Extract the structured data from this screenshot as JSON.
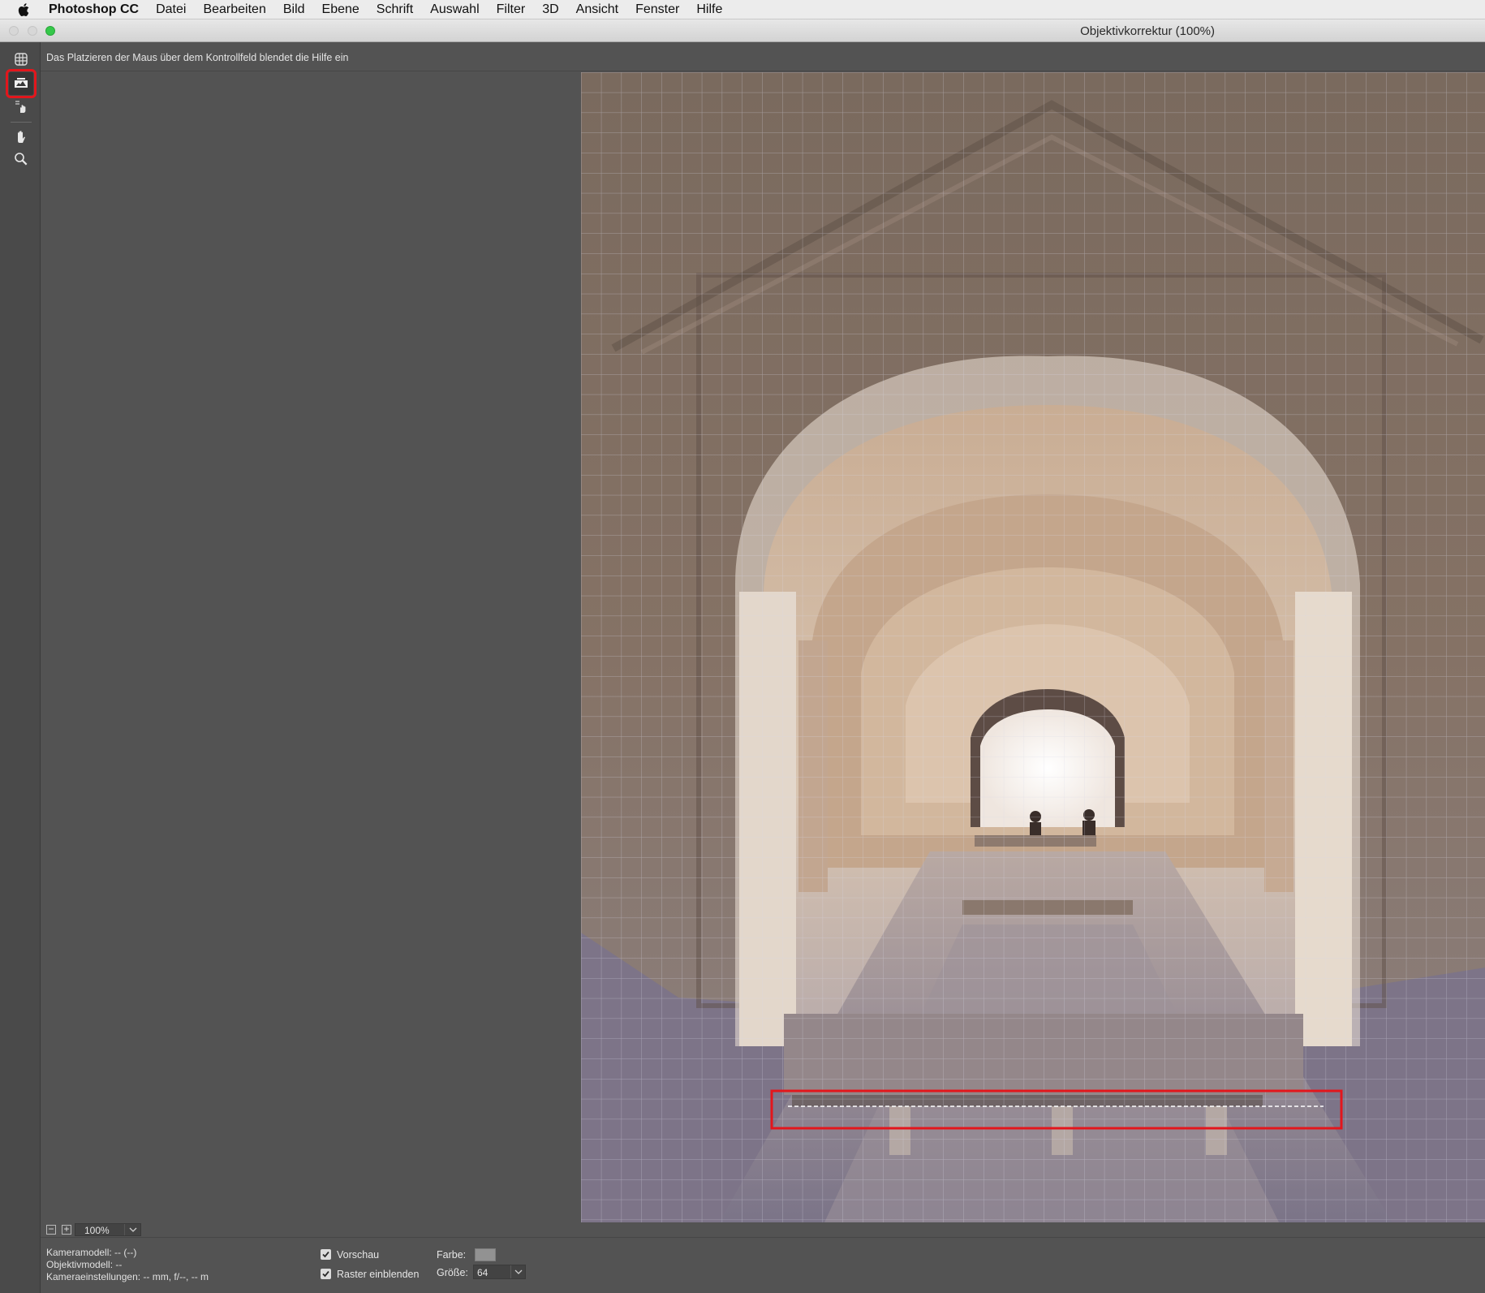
{
  "menubar": {
    "apple_icon": "apple-icon",
    "app_name": "Photoshop CC",
    "items": [
      "Datei",
      "Bearbeiten",
      "Bild",
      "Ebene",
      "Schrift",
      "Auswahl",
      "Filter",
      "3D",
      "Ansicht",
      "Fenster",
      "Hilfe"
    ]
  },
  "window": {
    "title": "Objektivkorrektur (100%)"
  },
  "tools": [
    {
      "name": "verzerrung-entfernen-icon"
    },
    {
      "name": "gerade-ausrichten-icon",
      "active": true
    },
    {
      "name": "raster-verschieben-icon"
    },
    {
      "name": "hand-icon"
    },
    {
      "name": "zoom-icon"
    }
  ],
  "help": {
    "text": "Das Platzieren der Maus über dem Kontrollfeld blendet die Hilfe ein"
  },
  "zoom": {
    "minus": "−",
    "plus": "+",
    "value": "100%"
  },
  "info": {
    "camera_model": "Kameramodell: -- (--)",
    "lens_model": "Objektivmodell: --",
    "camera_settings": "Kameraeinstellungen: -- mm, f/--, -- m"
  },
  "options": {
    "preview_label": "Vorschau",
    "preview_checked": true,
    "grid_label": "Raster einblenden",
    "grid_checked": true,
    "color_label": "Farbe:",
    "grid_color": "#929292",
    "size_label": "Größe:",
    "size_value": "64"
  },
  "colors": {
    "highlight": "#e3161c",
    "panel": "#535353",
    "zoom_button": "#35c84a"
  }
}
